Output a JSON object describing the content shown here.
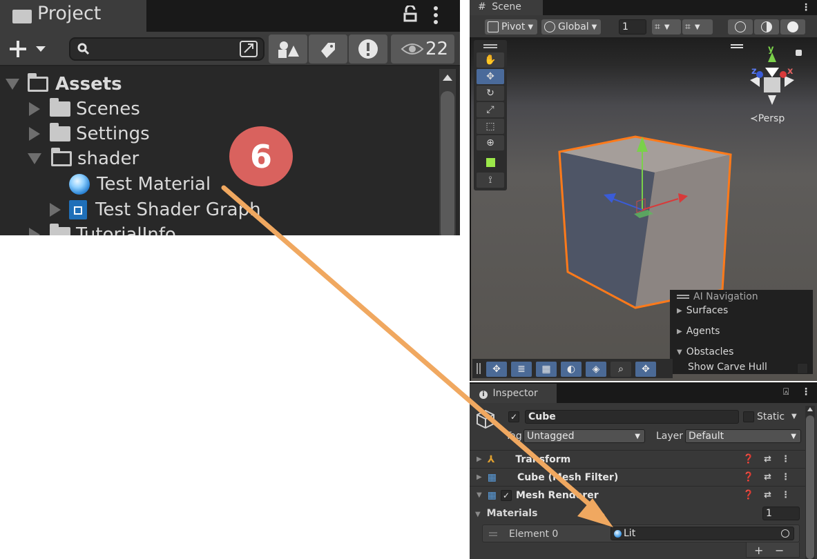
{
  "project": {
    "tab_title": "Project",
    "hidden_count": "22",
    "tree": {
      "assets": "Assets",
      "scenes": "Scenes",
      "settings": "Settings",
      "shader": "shader",
      "test_material": "Test Material",
      "test_shader_graph": "Test Shader Graph",
      "tutorial_info": "TutorialInfo"
    }
  },
  "scene": {
    "tab_title": "Scene",
    "pivot": "Pivot",
    "global": "Global",
    "grid_value": "1",
    "persp": "Persp",
    "gizmo_axes": {
      "x": "x",
      "y": "y",
      "z": "z"
    },
    "ai_navigation": {
      "title": "AI Navigation",
      "surfaces": "Surfaces",
      "agents": "Agents",
      "obstacles": "Obstacles",
      "show_carve_hull": "Show Carve Hull"
    }
  },
  "inspector": {
    "tab_title": "Inspector",
    "object_name": "Cube",
    "static_label": "Static",
    "tag_label": "Tag",
    "tag_value": "Untagged",
    "layer_label": "Layer",
    "layer_value": "Default",
    "components": {
      "transform": "Transform",
      "mesh_filter": "Cube (Mesh Filter)",
      "mesh_renderer": "Mesh Renderer"
    },
    "materials_label": "Materials",
    "materials_count": "1",
    "element_label": "Element 0",
    "element_value": "Lit",
    "plus": "+",
    "minus": "−"
  },
  "annotation": {
    "step_number": "6",
    "colors": {
      "badge": "#d9625e",
      "arrow": "#f0a860",
      "cube_outline": "#ff7a1a"
    }
  },
  "colors": {
    "panel_bg": "#282828",
    "toolbar_bg": "#3c3c3c",
    "accent_blue": "#4a6a9a"
  }
}
